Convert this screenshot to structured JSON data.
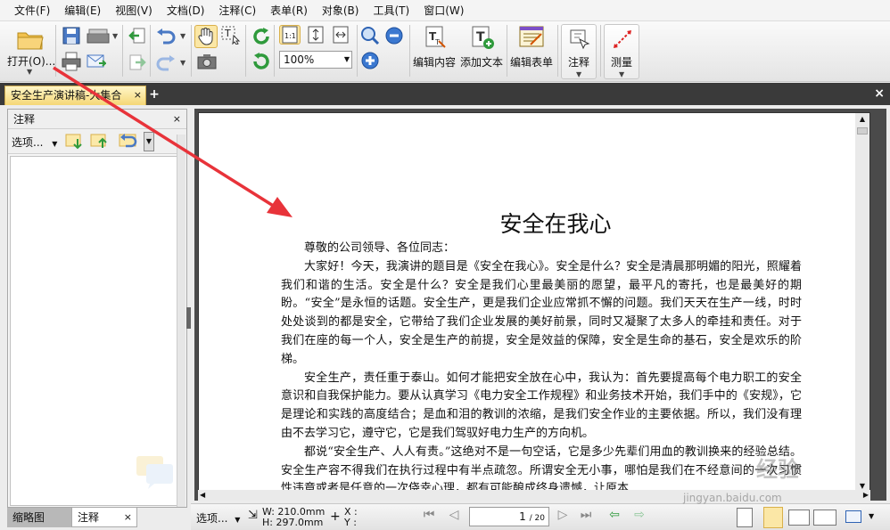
{
  "menu": [
    "文件(F)",
    "编辑(E)",
    "视图(V)",
    "文档(D)",
    "注释(C)",
    "表单(R)",
    "对象(B)",
    "工具(T)",
    "窗口(W)"
  ],
  "toolbar": {
    "open_label": "打开(O)...",
    "zoom_value": "100%",
    "edit_content_label": "编辑内容",
    "add_text_label": "添加文本",
    "edit_form_label": "编辑表单",
    "annotation_label": "注释",
    "measure_label": "测量"
  },
  "tabs": {
    "doc_tab_label": "安全生产演讲稿-大集合",
    "close": "×",
    "add": "+"
  },
  "left_panel": {
    "title": "注释",
    "options_label": "选项...",
    "bottom_tab_thumbnails": "缩略图",
    "bottom_tab_annotations": "注释"
  },
  "document": {
    "title": "安全在我心",
    "paragraphs": [
      "尊敬的公司领导、各位同志：",
      "大家好！今天，我演讲的题目是《安全在我心》。安全是什么？安全是清晨那明媚的阳光，照耀着我们和谐的生活。安全是什么？安全是我们心里最美丽的愿望，最平凡的寄托，也是最美好的期盼。“安全”是永恒的话题。安全生产，更是我们企业应常抓不懈的问题。我们天天在生产一线，时时处处谈到的都是安全，它带给了我们企业发展的美好前景，同时又凝聚了太多人的牵挂和责任。对于我们在座的每一个人，安全是生产的前提，安全是效益的保障，安全是生命的基石，安全是欢乐的阶梯。",
      "安全生产，责任重于泰山。如何才能把安全放在心中，我认为：首先要提高每个电力职工的安全意识和自我保护能力。要从认真学习《电力安全工作规程》和业务技术开始，我们手中的《安规》，它是理论和实践的高度结合；是血和泪的教训的浓缩，是我们安全作业的主要依据。所以，我们没有理由不去学习它，遵守它，它是我们驾驭好电力生产的方向机。",
      "都说“安全生产、人人有责。”这绝对不是一句空话，它是多少先辈们用血的教训换来的经验总结。安全生产容不得我们在执行过程中有半点疏忽。所谓安全无小事，哪怕是我们在不经意间的一次习惯性违章或者是任意的一次侥幸心理，都有可能酿成终身遗憾，让原本"
    ]
  },
  "status": {
    "options_label": "选项...",
    "width_label": "W: 210.0mm",
    "height_label": "H: 297.0mm",
    "x_label": "X :",
    "y_label": "Y :",
    "page_current": "1",
    "page_total": "/ 20"
  },
  "watermark": "经验",
  "watermark_url": "jingyan.baidu.com",
  "colors": {
    "accent_red": "#e8333a",
    "tab_active": "#f5d776",
    "tabbar_bg": "#3a3a3a"
  }
}
